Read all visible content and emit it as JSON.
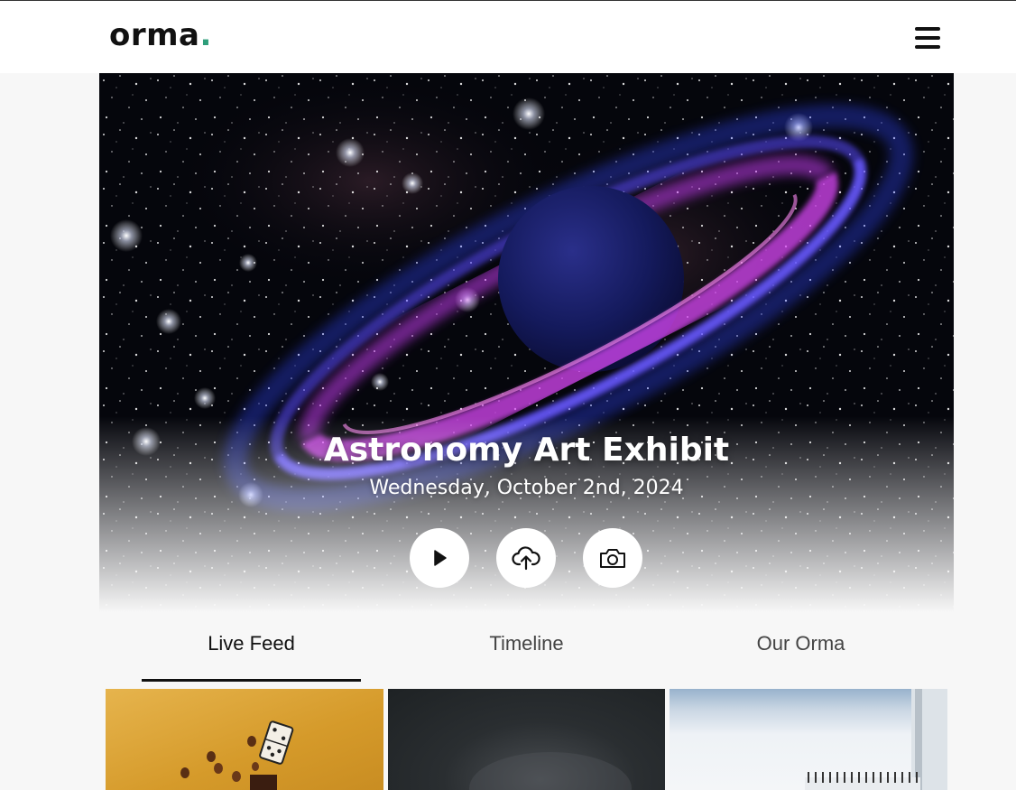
{
  "header": {
    "logo_text": "orma",
    "logo_dot": ".",
    "menu_icon": "hamburger-menu-icon"
  },
  "event": {
    "title": "Astronomy Art Exhibit",
    "date": "Wednesday, October 2nd, 2024"
  },
  "actions": [
    {
      "icon": "play-icon"
    },
    {
      "icon": "upload-cloud-icon"
    },
    {
      "icon": "camera-icon"
    }
  ],
  "tabs": [
    {
      "label": "Live Feed",
      "active": true
    },
    {
      "label": "Timeline",
      "active": false
    },
    {
      "label": "Our Orma",
      "active": false
    }
  ],
  "colors": {
    "accent_dot": "#2e9e7a",
    "text_dark": "#111111",
    "background": "#f7f7f7"
  }
}
